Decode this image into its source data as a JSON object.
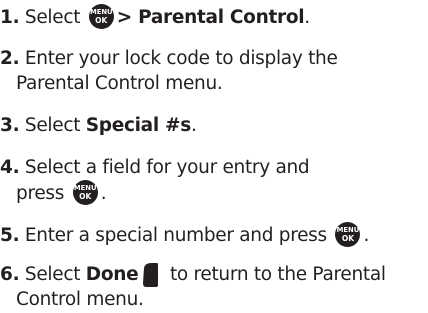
{
  "steps": [
    {
      "num": "1.",
      "pre": "Select ",
      "bold": "> Parental Control",
      "post": "."
    },
    {
      "num": "2.",
      "line1": "Enter your lock code to display the",
      "line2": "Parental Control menu."
    },
    {
      "num": "3.",
      "pre": "Select ",
      "bold": "Special #s",
      "post": "."
    },
    {
      "num": "4.",
      "line1": "Select a field for your entry and",
      "line2": "press ",
      "post": "."
    },
    {
      "num": "5.",
      "text": "Enter a special number and press ",
      "post": "."
    },
    {
      "num": "6.",
      "pre": "Select ",
      "bold": "Done",
      "line1rest": " to return to the Parental",
      "line2": "Control menu."
    }
  ],
  "menu_key": {
    "top": "MENU",
    "bottom": "OK"
  },
  "icons": {
    "menu_ok": "menu-ok-key-icon",
    "softkey": "left-softkey-icon"
  }
}
